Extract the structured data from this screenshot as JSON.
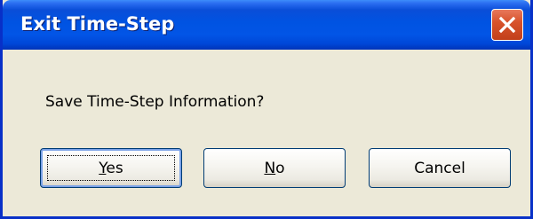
{
  "window": {
    "title": "Exit Time-Step"
  },
  "dialog": {
    "message": "Save Time-Step Information?"
  },
  "buttons": {
    "yes": {
      "mnemonic": "Y",
      "rest": "es"
    },
    "no": {
      "mnemonic": "N",
      "rest": "o"
    },
    "cancel": {
      "label": "Cancel"
    }
  },
  "icons": {
    "close": "close-icon"
  },
  "colors": {
    "titlebar": "#0053e2",
    "close_button": "#d8532c",
    "dialog_face": "#ece9d8",
    "border": "#0831c8"
  }
}
